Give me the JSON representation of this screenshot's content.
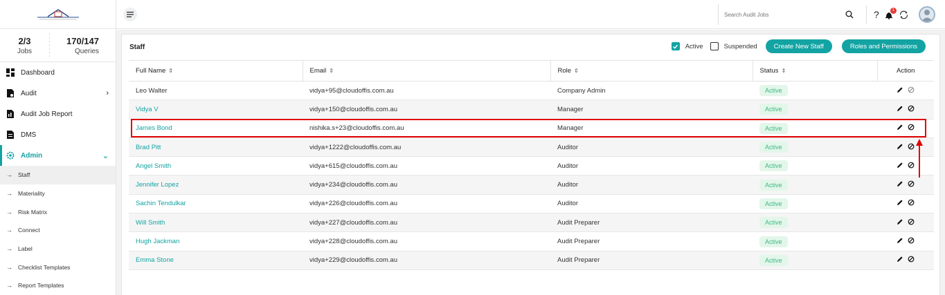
{
  "sidebar": {
    "stats": [
      {
        "value": "2/3",
        "label": "Jobs"
      },
      {
        "value": "170/147",
        "label": "Queries"
      }
    ],
    "nav": {
      "dashboard": "Dashboard",
      "audit": "Audit",
      "audit_job_report": "Audit Job Report",
      "dms": "DMS",
      "admin": "Admin"
    },
    "sub_items": {
      "staff": "Staff",
      "materiality": "Materiality",
      "risk_matrix": "Risk Matrix",
      "connect": "Connect",
      "label": "Label",
      "checklist_templates": "Checklist Templates",
      "report_templates": "Report Templates"
    }
  },
  "topbar": {
    "search_placeholder": "Search Audit Jobs",
    "notification_count": "1"
  },
  "page": {
    "title": "Staff",
    "filters": {
      "active": "Active",
      "suspended": "Suspended"
    },
    "buttons": {
      "create": "Create New Staff",
      "roles": "Roles and Permissions"
    }
  },
  "table": {
    "headers": {
      "full_name": "Full Name",
      "email": "Email",
      "role": "Role",
      "status": "Status",
      "action": "Action"
    },
    "rows": [
      {
        "name": "Leo Walter",
        "email": "vidya+95@cloudoffis.com.au",
        "role": "Company Admin",
        "status": "Active"
      },
      {
        "name": "Vidya V",
        "email": "vidya+150@cloudoffis.com.au",
        "role": "Manager",
        "status": "Active"
      },
      {
        "name": "James Bond",
        "email": "nishika.s+23@cloudoffis.com.au",
        "role": "Manager",
        "status": "Active"
      },
      {
        "name": "Brad Pitt",
        "email": "vidya+1222@cloudoffis.com.au",
        "role": "Auditor",
        "status": "Active"
      },
      {
        "name": "Angel Smith",
        "email": "vidya+615@cloudoffis.com.au",
        "role": "Auditor",
        "status": "Active"
      },
      {
        "name": "Jennifer Lopez",
        "email": "vidya+234@cloudoffis.com.au",
        "role": "Auditor",
        "status": "Active"
      },
      {
        "name": "Sachin Tendulkar",
        "email": "vidya+226@cloudoffis.com.au",
        "role": "Auditor",
        "status": "Active"
      },
      {
        "name": "Will Smith",
        "email": "vidya+227@cloudoffis.com.au",
        "role": "Audit Preparer",
        "status": "Active"
      },
      {
        "name": "Hugh Jackman",
        "email": "vidya+228@cloudoffis.com.au",
        "role": "Audit Preparer",
        "status": "Active"
      },
      {
        "name": "Emma Stone",
        "email": "vidya+229@cloudoffis.com.au",
        "role": "Audit Preparer",
        "status": "Active"
      }
    ]
  },
  "colors": {
    "accent": "#13a3a3",
    "highlight": "#e00000",
    "status_bg": "#e3f6ea",
    "status_text": "#3fb883"
  }
}
